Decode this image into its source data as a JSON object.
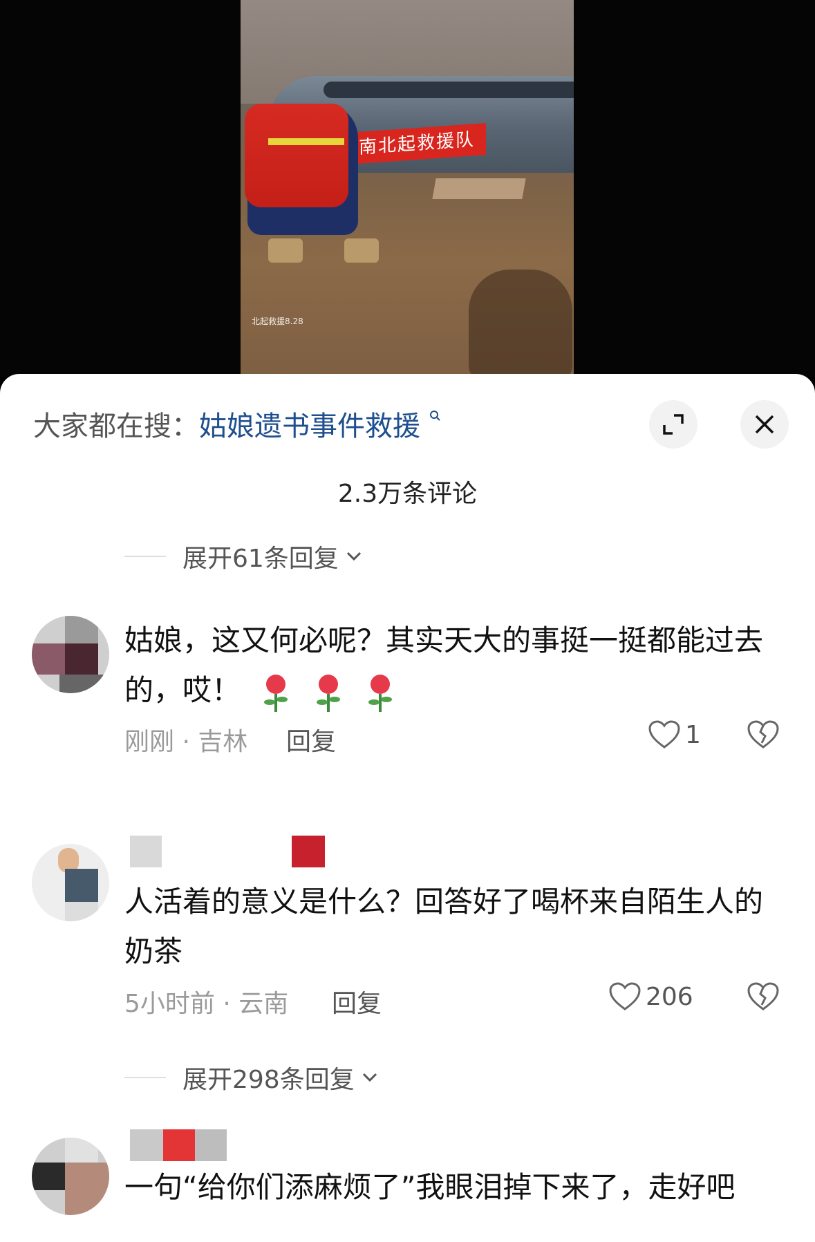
{
  "video": {
    "banner_text": "南北起救援队",
    "watermark": "北起救援8.28"
  },
  "sheet": {
    "search_prefix": "大家都在搜：",
    "search_term": "姑娘遗书事件救援",
    "comments_count": "2.3万条评论",
    "expand_top": "展开61条回复"
  },
  "comments": [
    {
      "text": "姑娘，这又何必呢？其实天大的事挺一挺都能过去的，哎！",
      "emojis": [
        "rose-emoji",
        "rose-emoji",
        "rose-emoji"
      ],
      "time_location": "刚刚 · 吉林",
      "reply_label": "回复",
      "likes": "1"
    },
    {
      "text": "人活着的意义是什么？回答好了喝杯来自陌生人的奶茶",
      "time_location": "5小时前 · 云南",
      "reply_label": "回复",
      "likes": "206",
      "expand_replies": "展开298条回复"
    },
    {
      "text": "一句“给你们添麻烦了”我眼泪掉下来了，走好吧"
    }
  ],
  "colors": {
    "link": "#1f4f8f",
    "banner_red": "#d8261f",
    "text_gray": "#9a9a9a"
  }
}
